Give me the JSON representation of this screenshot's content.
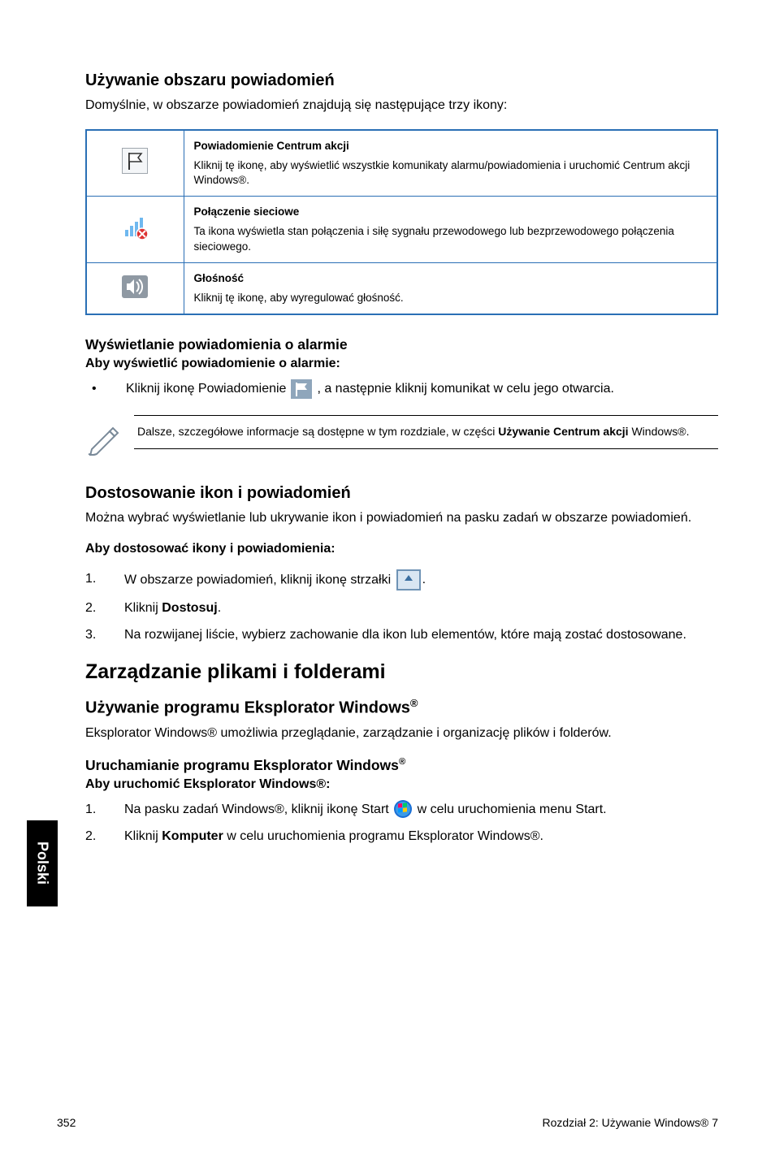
{
  "side_tab": "Polski",
  "section1": {
    "heading": "Używanie obszaru powiadomień",
    "intro": "Domyślnie, w obszarze powiadomień znajdują się następujące trzy ikony:"
  },
  "table": {
    "rows": [
      {
        "title": "Powiadomienie Centrum akcji",
        "desc": "Kliknij tę ikonę, aby wyświetlić wszystkie komunikaty alarmu/powiadomienia i uruchomić Centrum akcji Windows®."
      },
      {
        "title": "Połączenie sieciowe",
        "desc": "Ta ikona wyświetla stan połączenia i siłę sygnału przewodowego lub bezprzewodowego połączenia sieciowego."
      },
      {
        "title": "Głośność",
        "desc": "Kliknij tę ikonę, aby wyregulować głośność."
      }
    ]
  },
  "alert": {
    "heading": "Wyświetlanie powiadomienia o alarmie",
    "sub": "Aby wyświetlić powiadomienie o alarmie:",
    "bullet_pre": "Kliknij ikonę Powiadomienie",
    "bullet_post": ", a następnie kliknij komunikat w celu jego otwarcia."
  },
  "note": {
    "pre": "Dalsze, szczegółowe informacje są dostępne w tym rozdziale, w części ",
    "bold": "Używanie Centrum akcji",
    "post": " Windows®."
  },
  "customize": {
    "heading": "Dostosowanie ikon i powiadomień",
    "intro": "Można wybrać wyświetlanie lub ukrywanie ikon i powiadomień na pasku zadań w obszarze powiadomień.",
    "sub": "Aby dostosować ikony i powiadomienia:",
    "step1": "W obszarze powiadomień, kliknij ikonę strzałki",
    "step1_post": ".",
    "step2_pre": "Kliknij ",
    "step2_bold": "Dostosuj",
    "step2_post": ".",
    "step3": "Na rozwijanej liście, wybierz zachowanie dla ikon lub elementów, które mają zostać dostosowane."
  },
  "manage": {
    "heading": "Zarządzanie plikami i folderami",
    "sub1": "Używanie programu Eksplorator Windows",
    "sub1_sup": "®",
    "intro": "Eksplorator Windows® umożliwia przeglądanie, zarządzanie i organizację plików i folderów.",
    "sub2": "Uruchamianie programu Eksplorator Windows",
    "sub2_sup": "®",
    "sub3": "Aby uruchomić Eksplorator Windows®:",
    "step1_pre": "Na pasku zadań Windows®, kliknij ikonę Start",
    "step1_post": " w celu uruchomienia menu Start.",
    "step2_pre": "Kliknij ",
    "step2_bold": "Komputer",
    "step2_post": " w celu uruchomienia programu Eksplorator Windows®."
  },
  "footer": {
    "page": "352",
    "chapter": "Rozdział 2: Używanie Windows® 7"
  }
}
